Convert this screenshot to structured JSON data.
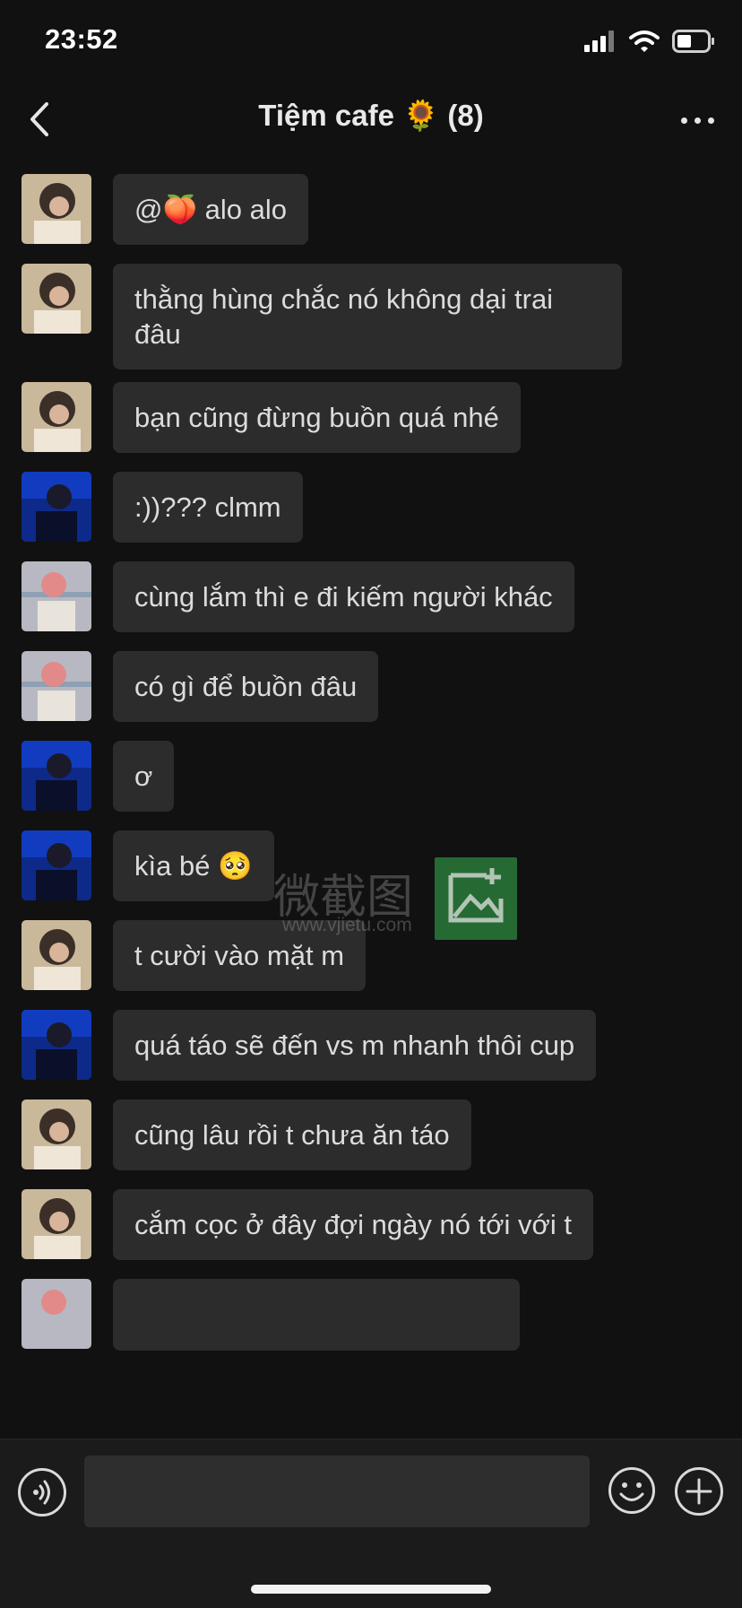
{
  "status": {
    "time": "23:52"
  },
  "header": {
    "title": "Tiệm cafe 🌻 (8)"
  },
  "messages": [
    {
      "avatar": "avatar-a",
      "text": "@🍑 alo alo"
    },
    {
      "avatar": "avatar-a",
      "text": "thằng hùng chắc nó không dại trai đâu"
    },
    {
      "avatar": "avatar-a",
      "text": "bạn cũng đừng buồn quá nhé"
    },
    {
      "avatar": "avatar-b",
      "text": ":))??? clmm"
    },
    {
      "avatar": "avatar-c",
      "text": "cùng lắm thì e đi kiếm người khác"
    },
    {
      "avatar": "avatar-c",
      "text": "có gì để buồn đâu"
    },
    {
      "avatar": "avatar-b",
      "text": "ơ"
    },
    {
      "avatar": "avatar-b",
      "text": "kìa bé 🥺"
    },
    {
      "avatar": "avatar-a",
      "text": "t cười vào mặt m"
    },
    {
      "avatar": "avatar-b",
      "text": "quá táo sẽ đến vs m nhanh thôi cup"
    },
    {
      "avatar": "avatar-a",
      "text": "cũng lâu rồi t chưa ăn táo"
    },
    {
      "avatar": "avatar-a",
      "text": "cắm cọc ở đây đợi ngày nó tới với t"
    }
  ],
  "watermark": {
    "text": "微截图",
    "url": "www.vjietu.com"
  },
  "colors": {
    "background": "#111111",
    "bubble": "#2c2c2c",
    "text": "#dcdcdc",
    "accent_watermark": "#2a7a3a"
  }
}
